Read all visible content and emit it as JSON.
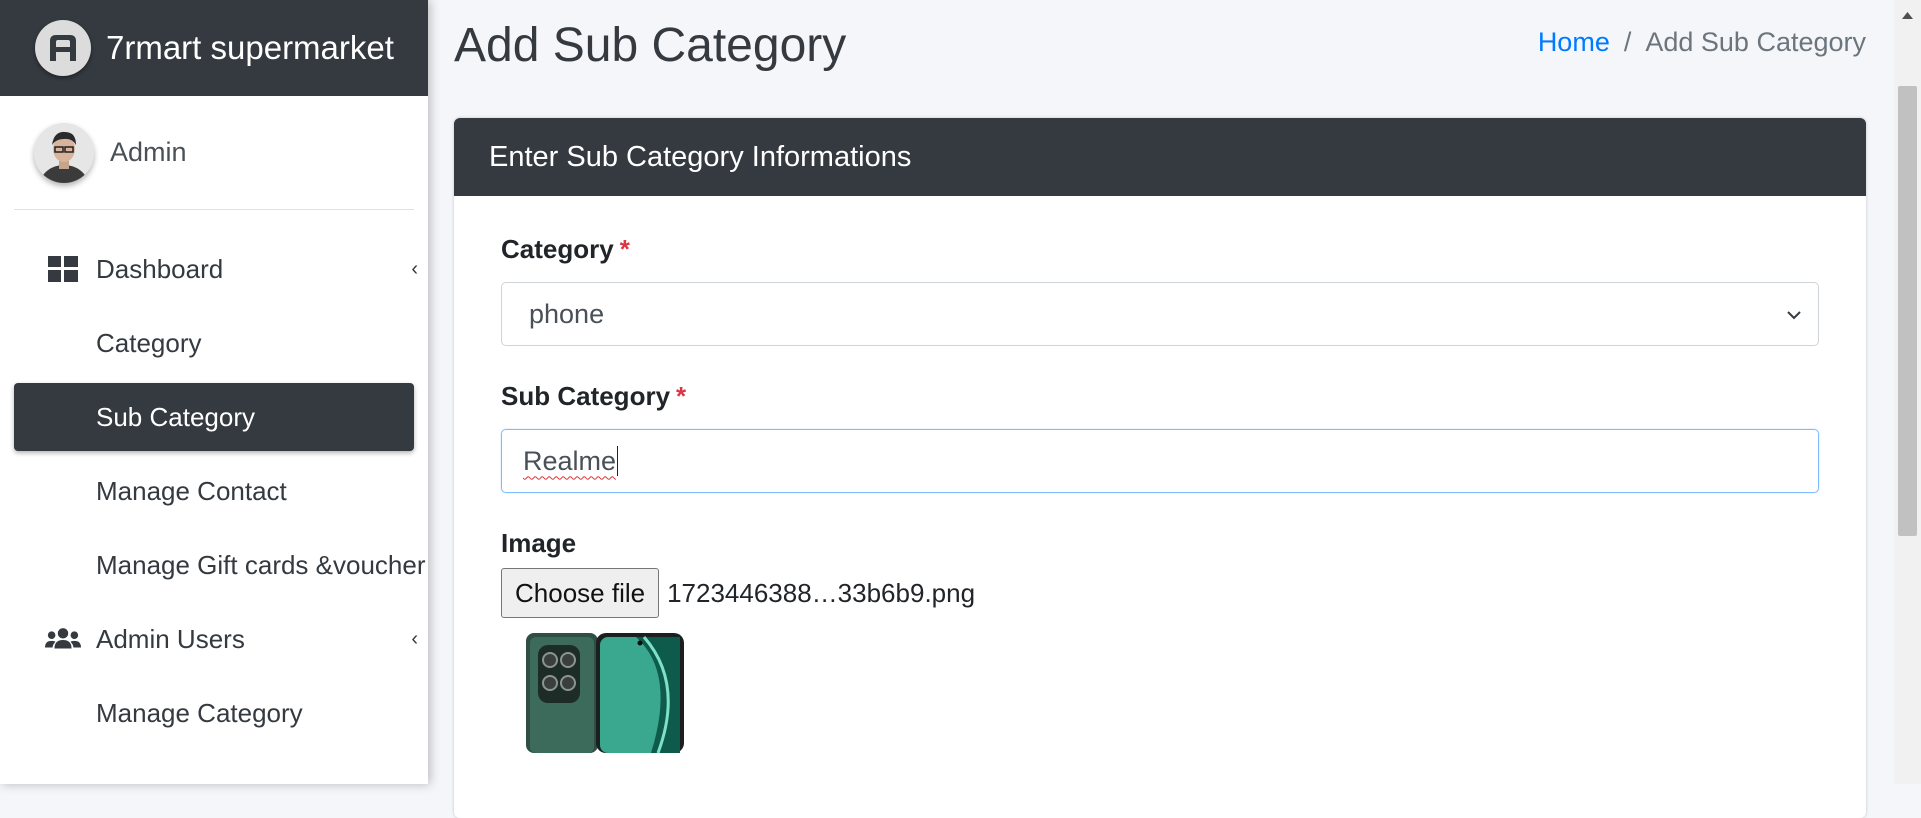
{
  "brand": {
    "name": "7rmart supermarket",
    "logo_icon": "brand-logo-icon"
  },
  "user": {
    "name": "Admin"
  },
  "sidebar": {
    "items": [
      {
        "label": "Dashboard",
        "icon": "dashboard-grid-icon",
        "has_caret": true
      },
      {
        "label": "Category"
      },
      {
        "label": "Sub Category",
        "active": true
      },
      {
        "label": "Manage Contact"
      },
      {
        "label": "Manage Gift cards &voucher"
      },
      {
        "label": "Admin Users",
        "icon": "users-icon",
        "has_caret": true
      },
      {
        "label": "Manage Category"
      }
    ]
  },
  "page": {
    "title": "Add Sub Category"
  },
  "breadcrumb": {
    "home": "Home",
    "separator": "/",
    "current": "Add Sub Category"
  },
  "card": {
    "header": "Enter Sub Category Informations"
  },
  "form": {
    "category": {
      "label": "Category",
      "required_mark": "*",
      "selected": "phone"
    },
    "sub_category": {
      "label": "Sub Category",
      "required_mark": "*",
      "value": "Realme"
    },
    "image": {
      "label": "Image",
      "button": "Choose file",
      "file_name": "1723446388…33b6b9.png"
    }
  },
  "colors": {
    "header_dark": "#343a40",
    "link_blue": "#007bff",
    "required_red": "#dc3545",
    "focus_border": "#80bdff"
  }
}
